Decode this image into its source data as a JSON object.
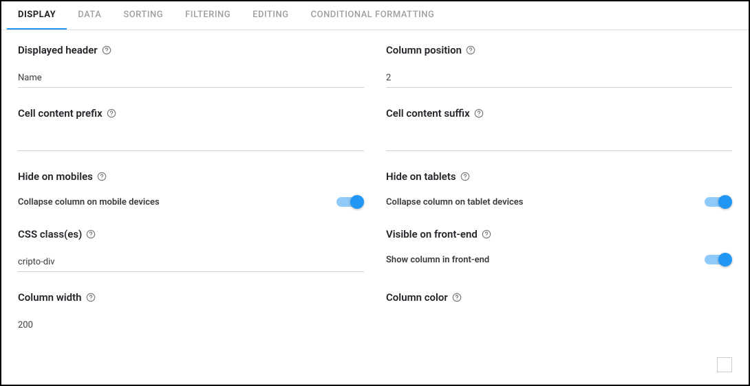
{
  "tabs": [
    {
      "label": "DISPLAY",
      "active": true
    },
    {
      "label": "DATA"
    },
    {
      "label": "SORTING"
    },
    {
      "label": "FILTERING"
    },
    {
      "label": "EDITING"
    },
    {
      "label": "CONDITIONAL FORMATTING"
    }
  ],
  "fields": {
    "displayed_header": {
      "label": "Displayed header",
      "value": "Name"
    },
    "column_position": {
      "label": "Column position",
      "value": "2"
    },
    "cell_prefix": {
      "label": "Cell content prefix",
      "value": ""
    },
    "cell_suffix": {
      "label": "Cell content suffix",
      "value": ""
    },
    "hide_mobiles": {
      "label": "Hide on mobiles",
      "desc": "Collapse column on mobile devices",
      "on": true
    },
    "hide_tablets": {
      "label": "Hide on tablets",
      "desc": "Collapse column on tablet devices",
      "on": true
    },
    "css_classes": {
      "label": "CSS class(es)",
      "value": "cripto-div"
    },
    "visible_frontend": {
      "label": "Visible on front-end",
      "desc": "Show column in front-end",
      "on": true
    },
    "column_width": {
      "label": "Column width",
      "value": "200"
    },
    "column_color": {
      "label": "Column color",
      "value": "#ffffff"
    }
  }
}
